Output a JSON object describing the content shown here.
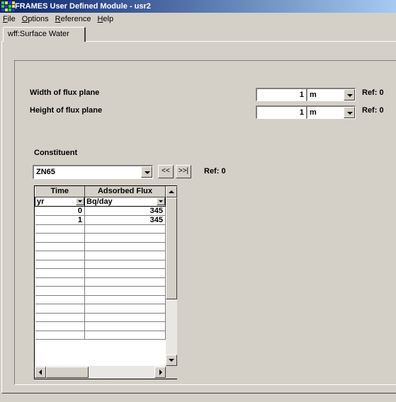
{
  "window": {
    "title": "FRAMES User Defined Module - usr2"
  },
  "menu": [
    {
      "hotkey": "F",
      "rest": "ile"
    },
    {
      "hotkey": "O",
      "rest": "ptions"
    },
    {
      "hotkey": "R",
      "rest": "eference"
    },
    {
      "hotkey": "H",
      "rest": "elp"
    }
  ],
  "tab": {
    "label": "wff:Surface Water"
  },
  "width_field": {
    "label": "Width of flux plane",
    "value": "1",
    "unit": "m",
    "ref": "Ref: 0"
  },
  "height_field": {
    "label": "Height of flux plane",
    "value": "1",
    "unit": "m",
    "ref": "Ref: 0"
  },
  "constituent": {
    "label": "Constituent",
    "selected": "ZN65",
    "prev_label": "<<",
    "next_label": ">>|",
    "ref": "Ref:  0"
  },
  "grid": {
    "headers": [
      "Time",
      "Adsorbed Flux"
    ],
    "units": [
      "yr",
      "Bq/day"
    ],
    "rows": [
      [
        "0",
        "345"
      ],
      [
        "1",
        "345"
      ],
      [
        "",
        ""
      ],
      [
        "",
        ""
      ],
      [
        "",
        ""
      ],
      [
        "",
        ""
      ],
      [
        "",
        ""
      ],
      [
        "",
        ""
      ],
      [
        "",
        ""
      ],
      [
        "",
        ""
      ],
      [
        "",
        ""
      ],
      [
        "",
        ""
      ],
      [
        "",
        ""
      ],
      [
        "",
        ""
      ],
      [
        "",
        ""
      ],
      [
        "",
        ""
      ]
    ]
  }
}
